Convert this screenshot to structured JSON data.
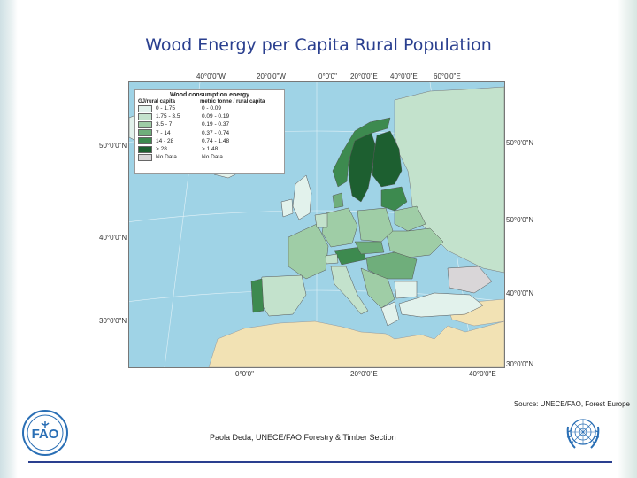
{
  "title": "Wood Energy per Capita Rural Population",
  "map": {
    "top_labels": [
      "40°0'0\"W",
      "20°0'0\"W",
      "0°0'0\"",
      "20°0'0\"E",
      "40°0'0\"E",
      "60°0'0\"E"
    ],
    "bottom_labels": [
      "0°0'0\"",
      "20°0'0\"E",
      "40°0'0\"E"
    ],
    "left_labels": [
      "50°0'0\"N",
      "40°0'0\"N",
      "30°0'0\"N"
    ],
    "right_labels": [
      "50°0'0\"N",
      "50°0'0\"N",
      "40°0'0\"N",
      "30°0'0\"N"
    ],
    "legend": {
      "title": "Wood consumption energy",
      "col1_header": "GJ/rural capita",
      "col2_header": "metric tonne / rural capita",
      "classes": [
        {
          "gj": "0 - 1.75",
          "mt": "0 - 0.09",
          "color": "#e2f2ec"
        },
        {
          "gj": "1.75 - 3.5",
          "mt": "0.09 - 0.19",
          "color": "#c3e2cc"
        },
        {
          "gj": "3.5 - 7",
          "mt": "0.19 - 0.37",
          "color": "#9fcda6"
        },
        {
          "gj": "7 - 14",
          "mt": "0.37 - 0.74",
          "color": "#6fae7b"
        },
        {
          "gj": "14 - 28",
          "mt": "0.74 - 1.48",
          "color": "#3d8a4f"
        },
        {
          "gj": "> 28",
          "mt": "> 1.48",
          "color": "#1d5f30"
        },
        {
          "gj": "No Data",
          "mt": "No Data",
          "color": "#d9d6d8"
        }
      ]
    },
    "colors": {
      "sea": "#9fd3e6",
      "africa": "#f2e2b4",
      "no_data": "#d9d6d8"
    }
  },
  "source": "Source: UNECE/FAO, Forest Europe",
  "author": "Paola Deda, UNECE/FAO Forestry & Timber Section",
  "logos": {
    "left": "fao-logo",
    "right": "un-emblem"
  },
  "accent_color": "#2a3f8f"
}
